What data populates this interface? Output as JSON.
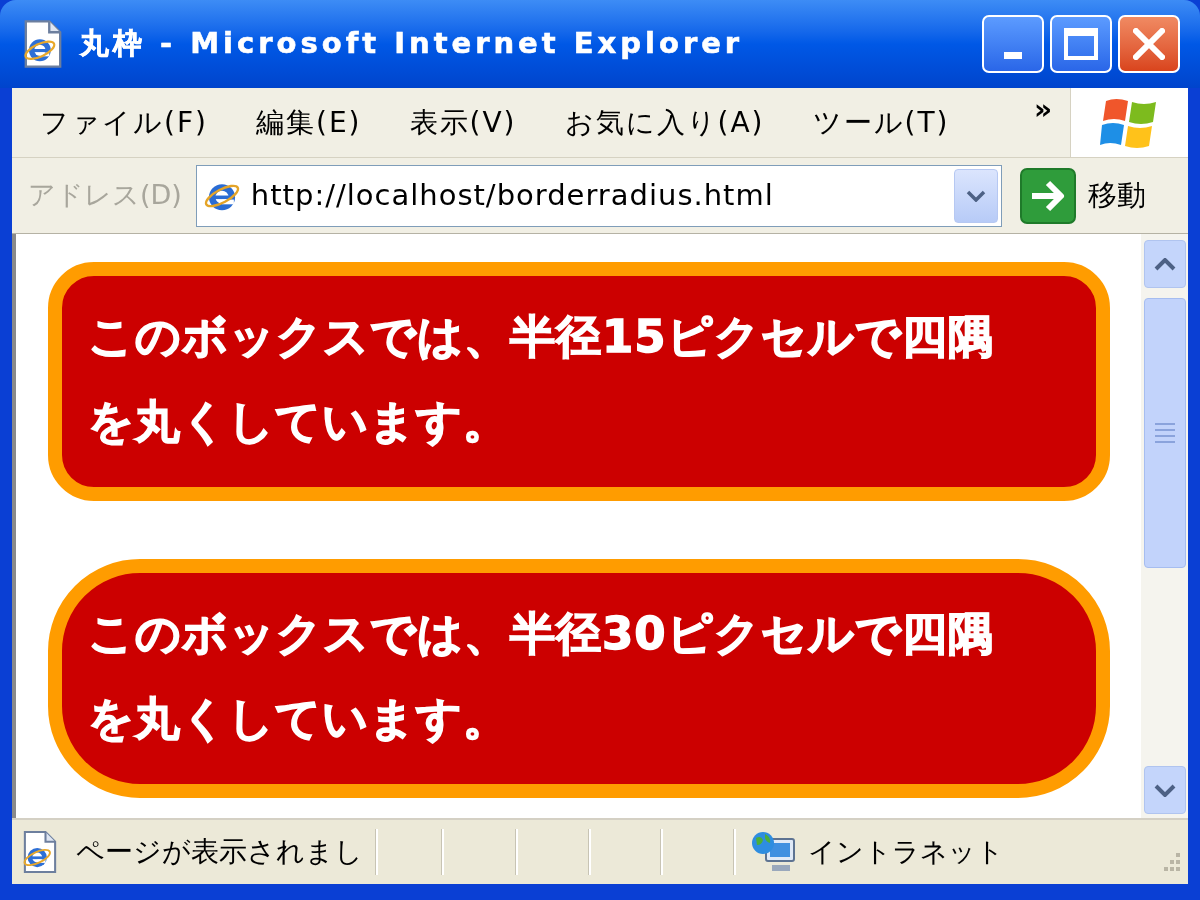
{
  "window": {
    "title": "丸枠 - Microsoft Internet Explorer"
  },
  "menu_bar": {
    "items": [
      "ファイル(F)",
      "編集(E)",
      "表示(V)",
      "お気に入り(A)",
      "ツール(T)"
    ],
    "overflow": "»"
  },
  "address_bar": {
    "label": "アドレス(D)",
    "url": "http://localhost/borderradius.html",
    "go_label": "移動"
  },
  "content": {
    "boxes": [
      {
        "kind": "small",
        "text": "このボックスでは、半径15ピクセルで四隅を丸くしています。"
      },
      {
        "kind": "large",
        "text": "このボックスでは、半径30ピクセルで四隅を丸くしています。"
      }
    ]
  },
  "status_bar": {
    "message": "ページが表示されまし",
    "zone": "イントラネット"
  }
}
